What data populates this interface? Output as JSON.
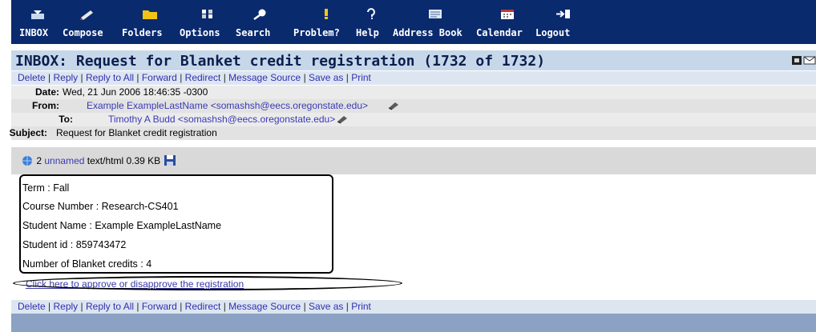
{
  "toolbar": {
    "items": [
      {
        "label": "INBOX",
        "icon": "inbox-icon"
      },
      {
        "label": "Compose",
        "icon": "compose-pen-icon"
      },
      {
        "label": "Folders",
        "icon": "folder-icon"
      },
      {
        "label": "Options",
        "icon": "options-icon"
      },
      {
        "label": "Search",
        "icon": "search-magnifier-icon"
      },
      {
        "label": "Problem?",
        "icon": "problem-exclamation-icon"
      },
      {
        "label": "Help",
        "icon": "help-question-icon"
      },
      {
        "label": "Address Book",
        "icon": "address-book-icon"
      },
      {
        "label": "Calendar",
        "icon": "calendar-icon"
      },
      {
        "label": "Logout",
        "icon": "logout-arrow-icon"
      }
    ],
    "colors": {
      "background": "#0a2a6e",
      "text": "#ffffff"
    }
  },
  "message": {
    "title": "INBOX: Request for Blanket credit registration (1732 of 1732)",
    "actions": {
      "delete": "Delete",
      "reply": "Reply",
      "reply_all": "Reply to All",
      "forward": "Forward",
      "redirect": "Redirect",
      "source": "Message Source",
      "save_as": "Save as",
      "print": "Print",
      "separator": "|"
    },
    "headers": {
      "date_label": "Date:",
      "date_value": "Wed, 21 Jun 2006 18:46:35 -0300",
      "from_label": "From:",
      "from_value": "Example ExampleLastName <somashsh@eecs.oregonstate.edu>",
      "to_label": "To:",
      "to_value": "Timothy A Budd <somashsh@eecs.oregonstate.edu>",
      "subject_label": "Subject:",
      "subject_value": "Request for Blanket credit registration"
    },
    "attachment": {
      "number": "2",
      "name": "unnamed",
      "type": "text/html",
      "size": "0.39 KB"
    },
    "body": {
      "term": "Term : Fall",
      "course": "Course Number : Research-CS401",
      "student_name": "Student Name : Example ExampleLastName",
      "student_id": "Student id : 859743472",
      "credits": "Number of Blanket credits : 4",
      "approve_link": "Click here to approve or disapprove the registration"
    }
  },
  "colors": {
    "title_bar": "#c6d7ea",
    "action_bar": "#dde6f0",
    "attach_bar": "#d9d9d9",
    "bottom_bar": "#8ba2c4",
    "link": "#3a3ab5"
  }
}
